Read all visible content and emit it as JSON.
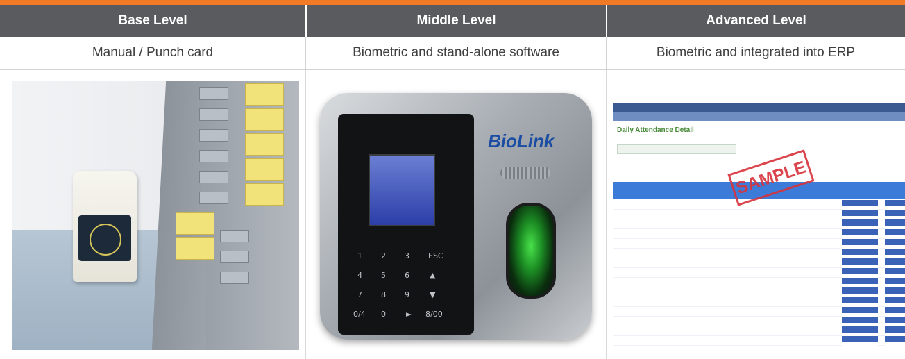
{
  "colors": {
    "accent": "#f07a26",
    "header_bg": "#595b5e",
    "header_text": "#ffffff",
    "sub_text": "#404040"
  },
  "columns": [
    {
      "title": "Base Level",
      "subtitle": "Manual / Punch card"
    },
    {
      "title": "Middle Level",
      "subtitle": "Biometric and stand-alone software"
    },
    {
      "title": "Advanced Level",
      "subtitle": "Biometric and integrated into ERP"
    }
  ],
  "device": {
    "brand": "BioLink",
    "keys": [
      "1",
      "2",
      "3",
      "ESC",
      "4",
      "5",
      "6",
      "▲",
      "7",
      "8",
      "9",
      "▼",
      "0/4",
      "0",
      "►",
      "8/00"
    ]
  },
  "erp": {
    "stamp": "SAMPLE",
    "page_title": "Daily Attendance Detail"
  }
}
